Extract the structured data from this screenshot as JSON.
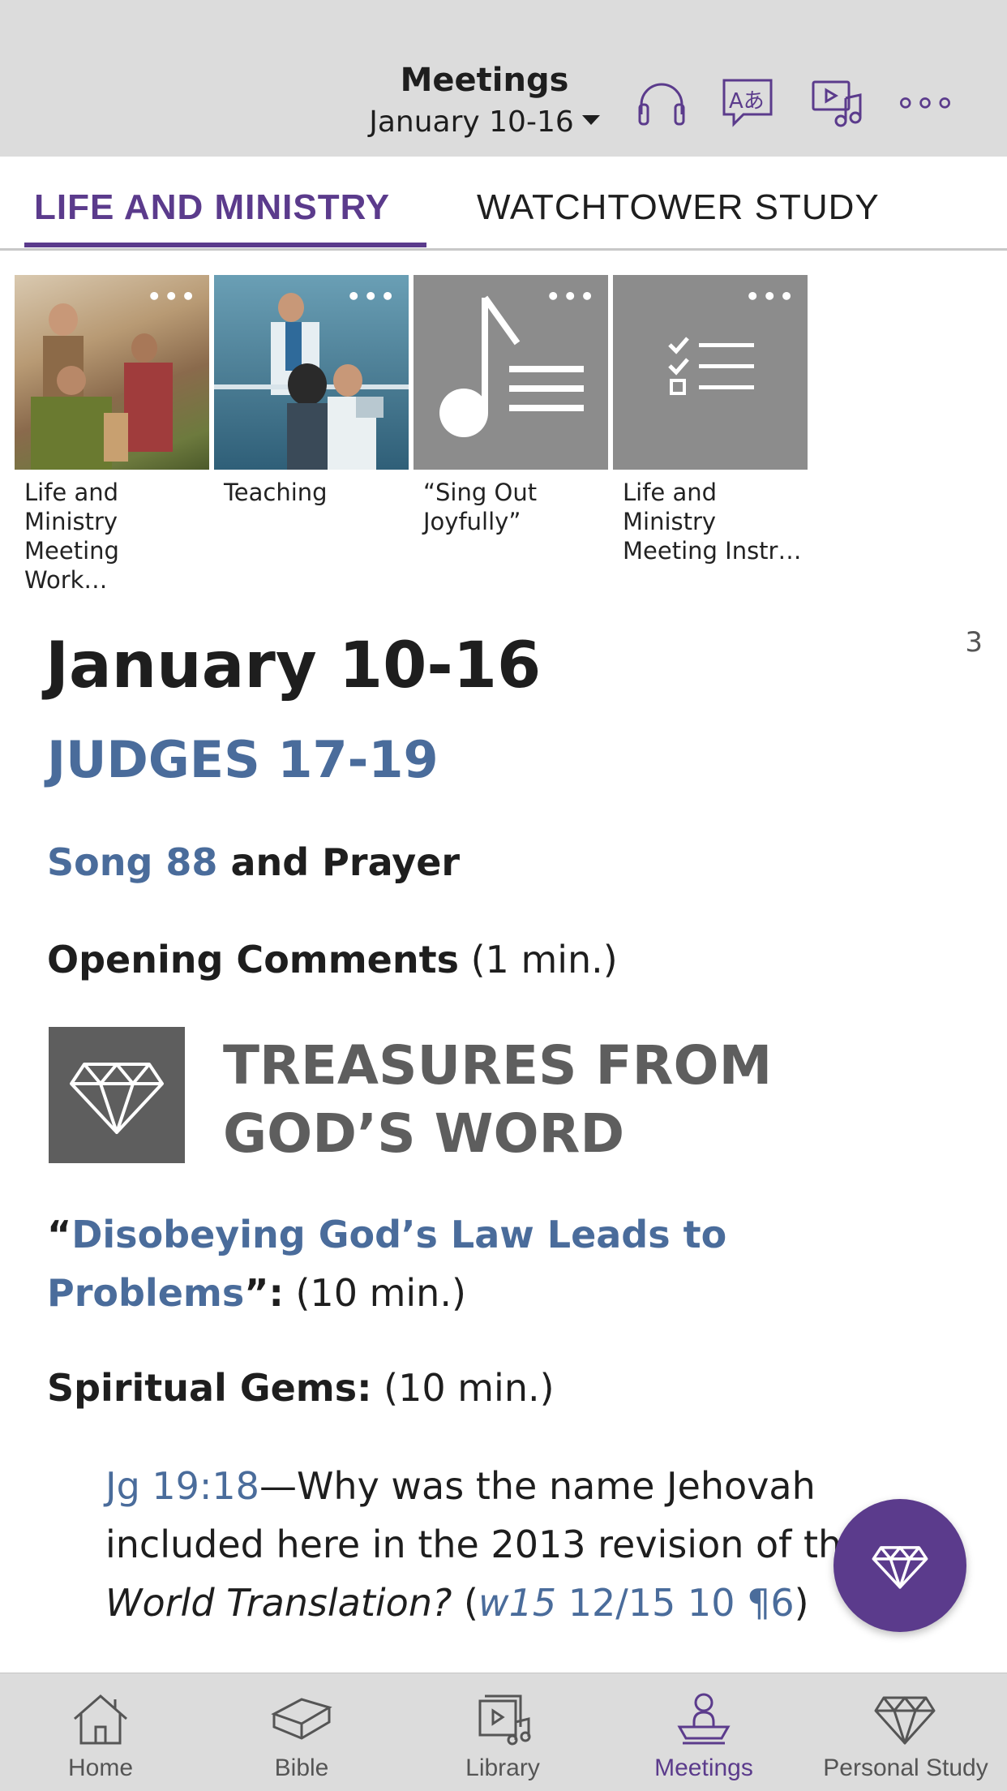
{
  "header": {
    "title": "Meetings",
    "date": "January 10-16",
    "icons": [
      "headphones-icon",
      "language-icon",
      "media-icon",
      "more-icon"
    ]
  },
  "tabs": [
    {
      "label": "LIFE AND MINISTRY",
      "active": true
    },
    {
      "label": "WATCHTOWER STUDY",
      "active": false
    }
  ],
  "thumbnails": [
    {
      "caption": "Life and Ministry Meeting Work…"
    },
    {
      "caption": "Teaching"
    },
    {
      "caption": "“Sing Out Joyfully”"
    },
    {
      "caption": "Life and Ministry Meeting Instr…"
    }
  ],
  "article": {
    "page_number": "3",
    "date_heading": "January 10-16",
    "bible_reading": "JUDGES 17-19",
    "song_link": "Song 88",
    "song_rest": " and Prayer",
    "opening_bold": "Opening Comments",
    "opening_time": " (1 min.)",
    "section_title": "TREASURES FROM GOD’S WORD",
    "talk_open_quote": "“",
    "talk_link": "Disobeying God’s Law Leads to Problems",
    "talk_close_quote": "”:",
    "talk_time": " (10 min.)",
    "gems_bold": "Spiritual Gems:",
    "gems_time": " (10 min.)",
    "gem_ref": "Jg 19:18",
    "gem_text_1": "—Why was the name Jehovah included here in the 2013 revision of the ",
    "gem_italic": "New World Translation?",
    "gem_paren_open": " (",
    "gem_ref2_italic": "w15",
    "gem_ref2_rest": " 12/15 10 ¶6",
    "gem_paren_close": ")"
  },
  "bottom_nav": [
    {
      "label": "Home",
      "icon": "home-icon",
      "active": false
    },
    {
      "label": "Bible",
      "icon": "bible-icon",
      "active": false
    },
    {
      "label": "Library",
      "icon": "library-icon",
      "active": false
    },
    {
      "label": "Meetings",
      "icon": "meetings-icon",
      "active": true
    },
    {
      "label": "Personal Study",
      "icon": "personal-study-icon",
      "active": false
    }
  ],
  "colors": {
    "accent": "#5b3b8c",
    "link": "#4a6c9b",
    "header_bg": "#dcdcdc"
  }
}
